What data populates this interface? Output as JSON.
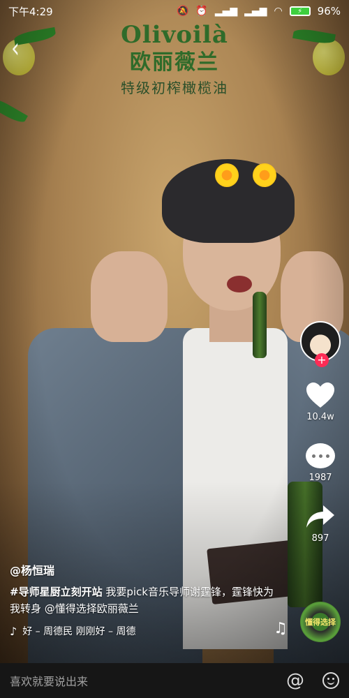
{
  "status_bar": {
    "time": "下午4:29",
    "battery": "96%",
    "mute_icon": "mute-icon",
    "alarm_icon": "alarm-icon",
    "signal_icon": "signal-icon",
    "wifi_icon": "wifi-icon"
  },
  "brand": {
    "name_en": "Olivoilà",
    "name_cn": "欧丽薇兰",
    "tagline": "特级初榨橄榄油"
  },
  "rail": {
    "follow_label": "+",
    "likes": "10.4w",
    "comments": "1987",
    "shares": "897",
    "disc_label": "懂得选择"
  },
  "caption": {
    "author": "@杨恒瑞",
    "hashtag": "#导师星厨立刻开站",
    "text": " 我要pick音乐导师谢霆锋，霆锋快为我转身 @懂得选择欧丽薇兰",
    "music": "好 – 周德民    刚刚好 – 周德"
  },
  "input_bar": {
    "placeholder": "喜欢就要说出来",
    "at_symbol": "@"
  },
  "colors": {
    "follow": "#fd2c55",
    "brand_green": "#2f6b2a"
  }
}
